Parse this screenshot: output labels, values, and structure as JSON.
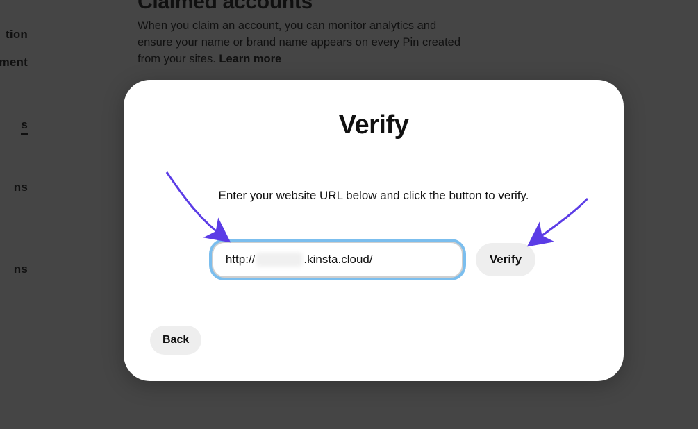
{
  "sidebar": {
    "items": [
      {
        "label": "tion"
      },
      {
        "label": "ment"
      },
      {
        "label": "s"
      },
      {
        "label": "ns"
      },
      {
        "label": "ns"
      }
    ],
    "active_index": 2
  },
  "background": {
    "section_title": "Claimed accounts",
    "section_desc_prefix": "When you claim an account, you can monitor analytics and ensure your name or brand name appears on every Pin created from your sites. ",
    "learn_more": "Learn more"
  },
  "modal": {
    "title": "Verify",
    "instruction": "Enter your website URL below and click the button to verify.",
    "url_prefix": "http://",
    "url_redacted": true,
    "url_suffix": ".kinsta.cloud/",
    "verify_label": "Verify",
    "back_label": "Back"
  },
  "annotations": {
    "arrow_color": "#5b3ce6"
  }
}
